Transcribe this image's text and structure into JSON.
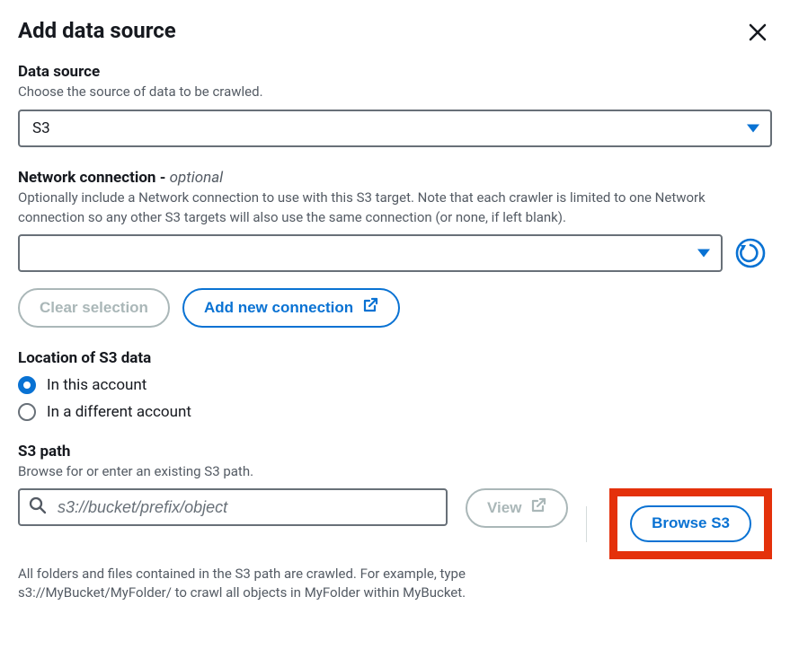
{
  "header": {
    "title": "Add data source"
  },
  "dataSource": {
    "label": "Data source",
    "description": "Choose the source of data to be crawled.",
    "value": "S3"
  },
  "networkConnection": {
    "label": "Network connection - ",
    "optional": "optional",
    "description": "Optionally include a Network connection to use with this S3 target. Note that each crawler is limited to one Network connection so any other S3 targets will also use the same connection (or none, if left blank).",
    "value": "",
    "clearButton": "Clear selection",
    "addButton": "Add new connection"
  },
  "location": {
    "label": "Location of S3 data",
    "options": [
      {
        "label": "In this account",
        "selected": true
      },
      {
        "label": "In a different account",
        "selected": false
      }
    ]
  },
  "s3path": {
    "label": "S3 path",
    "description": "Browse for or enter an existing S3 path.",
    "placeholder": "s3://bucket/prefix/object",
    "value": "",
    "viewButton": "View",
    "browseButton": "Browse S3",
    "helper": "All folders and files contained in the S3 path are crawled. For example, type s3://MyBucket/MyFolder/ to crawl all objects in MyFolder within MyBucket."
  }
}
